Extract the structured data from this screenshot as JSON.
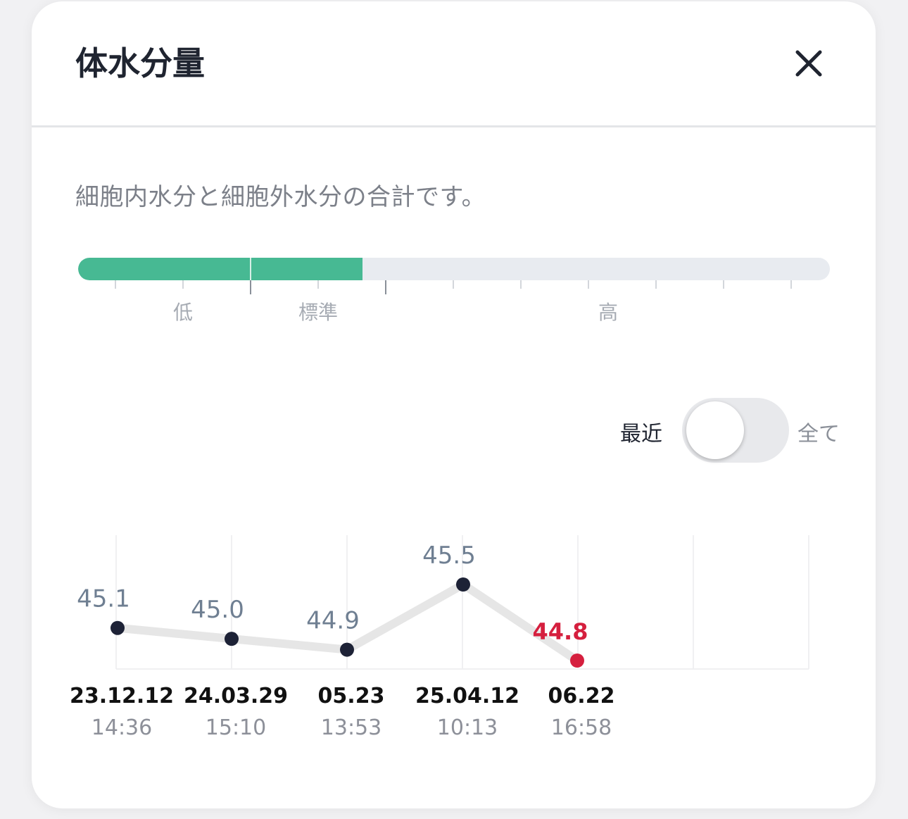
{
  "header": {
    "title": "体水分量"
  },
  "description": "細胞内水分と細胞外水分の合計です。",
  "gauge": {
    "level_fraction": 0.378,
    "labels": [
      "低",
      "標準",
      "高"
    ],
    "colors": {
      "fill": "#47b993",
      "track": "#e8ebf0"
    }
  },
  "toggle": {
    "left_label": "最近",
    "right_label": "全て",
    "selected": "最近"
  },
  "chart_data": {
    "type": "line",
    "x": [
      "23.12.12",
      "24.03.29",
      "05.23",
      "25.04.12",
      "06.22"
    ],
    "times": [
      "14:36",
      "15:10",
      "13:53",
      "10:13",
      "16:58"
    ],
    "series": [
      {
        "values": [
          45.1,
          45.0,
          44.9,
          45.5,
          44.8
        ]
      }
    ],
    "value_labels": [
      "45.1",
      "45.0",
      "44.9",
      "45.5",
      "44.8"
    ],
    "highlight_index": 4,
    "grid": true,
    "colors": {
      "point": "#1d2236",
      "highlight": "#d51f3e",
      "line": "#e6e6e6",
      "label": "#6f7f92"
    }
  }
}
